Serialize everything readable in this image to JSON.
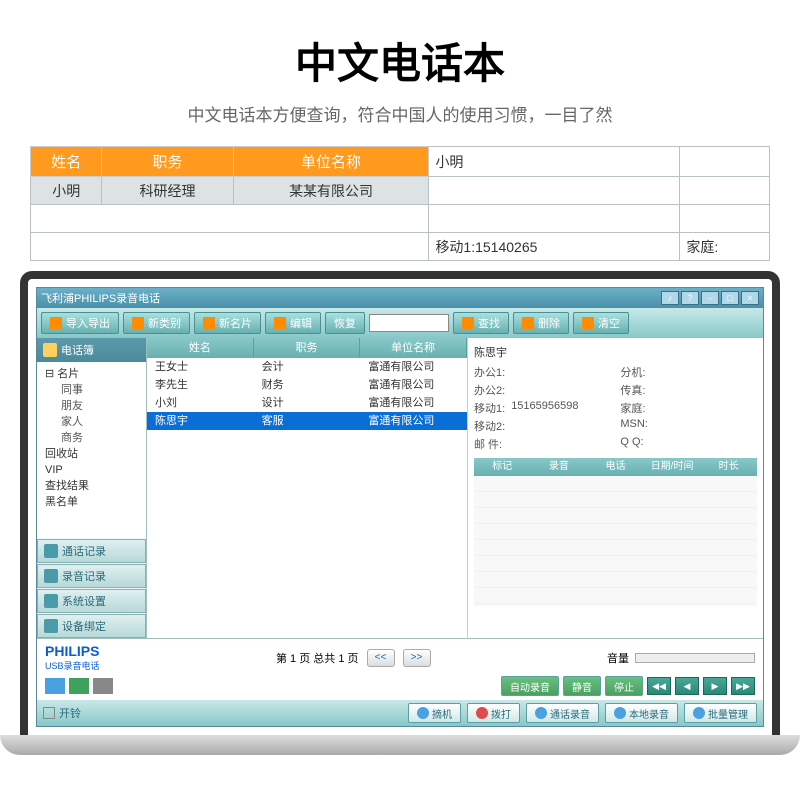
{
  "hero": {
    "title": "中文电话本",
    "subtitle": "中文电话本方便查询，符合中国人的使用习惯，一目了然"
  },
  "top_table": {
    "headers": [
      "姓名",
      "职务",
      "单位名称"
    ],
    "row": [
      "小明",
      "科研经理",
      "某某有限公司"
    ],
    "detail_name": "小明",
    "mobile_label": "移动1:15140265",
    "home_label": "家庭:"
  },
  "window": {
    "title": "飞利浦PHILIPS录音电话"
  },
  "toolbar": {
    "import": "导入导出",
    "new_category": "新类别",
    "new_card": "新名片",
    "edit": "编辑",
    "restore": "恢复",
    "find": "查找",
    "delete": "删除",
    "clear": "清空"
  },
  "sidebar": {
    "phonebook": "电话簿",
    "tree": {
      "card": "名片",
      "subs": [
        "同事",
        "朋友",
        "家人",
        "商务"
      ],
      "recycle": "回收站",
      "vip": "VIP",
      "search_result": "查找结果",
      "blacklist": "黑名单"
    },
    "nav": {
      "call_log": "通话记录",
      "rec_log": "录音记录",
      "settings": "系统设置",
      "device": "设备绑定"
    }
  },
  "contact_list": {
    "headers": [
      "姓名",
      "职务",
      "单位名称"
    ],
    "rows": [
      {
        "name": "王女士",
        "job": "会计",
        "company": "富通有限公司"
      },
      {
        "name": "李先生",
        "job": "财务",
        "company": "富通有限公司"
      },
      {
        "name": "小刘",
        "job": "设计",
        "company": "富通有限公司"
      },
      {
        "name": "陈思宇",
        "job": "客服",
        "company": "富通有限公司"
      }
    ],
    "selected_index": 3
  },
  "detail": {
    "name": "陈思宇",
    "fields": {
      "office1_label": "办公1:",
      "ext_label": "分机:",
      "office2_label": "办公2:",
      "fax_label": "传真:",
      "mobile1_label": "移动1:",
      "mobile1_value": "15165956598",
      "home_label": "家庭:",
      "mobile2_label": "移动2:",
      "msn_label": "MSN:",
      "email_label": "邮 件:",
      "qq_label": "Q Q:"
    },
    "call_headers": [
      "标记",
      "录音",
      "电话",
      "日期/时间",
      "时长"
    ]
  },
  "pager": {
    "text": "第 1 页 总共 1 页",
    "prev": "<<",
    "next": ">>"
  },
  "brand": {
    "name": "PHILIPS",
    "sub": "USB录音电话"
  },
  "volume_label": "音量",
  "footer": {
    "bell": "开铃",
    "auto_rec": "自动录音",
    "mute": "静音",
    "stop": "停止",
    "pickup": "摘机",
    "dial": "拨打",
    "call_rec": "通话录音",
    "local_rec": "本地录音",
    "batch": "批量管理"
  }
}
